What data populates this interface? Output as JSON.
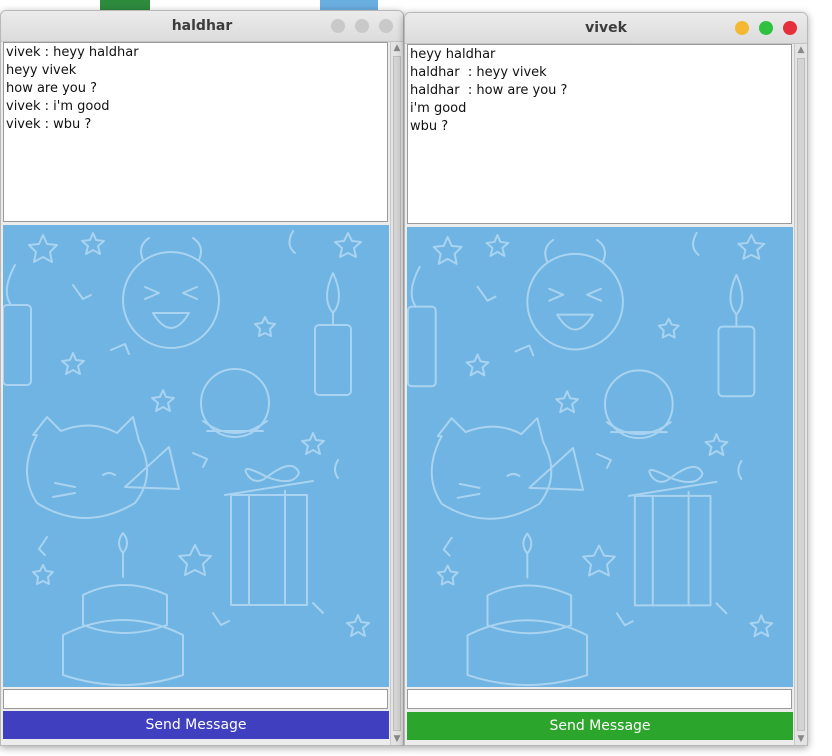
{
  "colors": {
    "wallpaper": "#6fb4e2",
    "doodle_line": "#a9d3f0",
    "send_left": "#3f3fbf",
    "send_right": "#2ca52c"
  },
  "windows": [
    {
      "title": "haldhar",
      "messages": [
        "vivek : heyy haldhar",
        "heyy vivek",
        "how are you ?",
        "vivek : i'm good",
        "vivek : wbu ?"
      ],
      "input_value": "",
      "send_label": "Send Message"
    },
    {
      "title": "vivek",
      "messages": [
        "heyy haldhar",
        "haldhar  : heyy vivek",
        "haldhar  : how are you ?",
        "i'm good",
        "wbu ?"
      ],
      "input_value": "",
      "send_label": "Send Message"
    }
  ],
  "scroll": {
    "up_glyph": "▲",
    "down_glyph": "▼"
  }
}
